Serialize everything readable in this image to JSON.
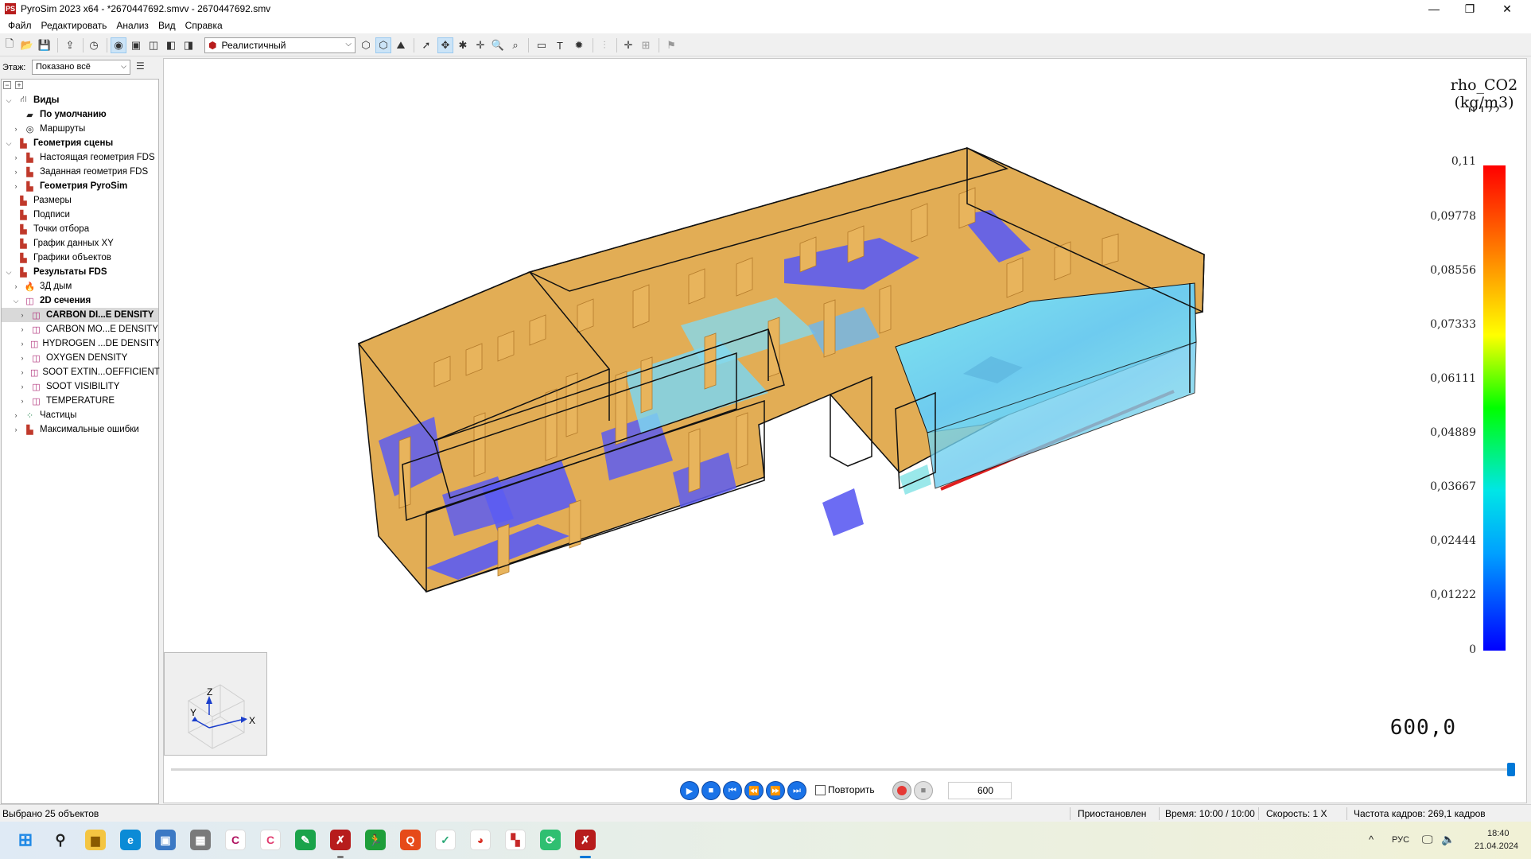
{
  "window": {
    "title": "PyroSim 2023 x64 - *2670447692.smvv - 2670447692.smv",
    "app_icon_text": "PS",
    "controls": {
      "minimize": "—",
      "maximize": "❐",
      "close": "✕"
    }
  },
  "menu": {
    "items": [
      "Файл",
      "Редактировать",
      "Анализ",
      "Вид",
      "Справка"
    ]
  },
  "toolbar": {
    "view_mode": "Реалистичный",
    "text_tool_glyph": "T"
  },
  "floor": {
    "label": "Этаж:",
    "value": "Показано всё"
  },
  "tree": {
    "views": "Виды",
    "default_view": "По умолчанию",
    "routes": "Маршруты",
    "scene_geometry": "Геометрия сцены",
    "actual_fds_geometry": "Настоящая геометрия FDS",
    "specified_fds_geometry": "Заданная геометрия FDS",
    "pyrosim_geometry": "Геометрия PyroSim",
    "dimensions": "Размеры",
    "labels": "Подписи",
    "sample_points": "Точки отбора",
    "xy_plots": "График данных XY",
    "object_plots": "Графики объектов",
    "fds_results": "Результаты FDS",
    "smoke_3d": "3Д дым",
    "slices_2d": "2D сечения",
    "slice_items": [
      "CARBON DI...E DENSITY",
      "CARBON MO...E DENSITY",
      "HYDROGEN ...DE DENSITY",
      "OXYGEN DENSITY",
      "SOOT EXTIN...OEFFICIENT",
      "SOOT VISIBILITY",
      "TEMPERATURE"
    ],
    "particles": "Частицы",
    "max_errors": "Максимальные ошибки"
  },
  "legend": {
    "quantity": "rho_CO2",
    "unit": "(kg/m3)",
    "clipped_value": "0,122",
    "ticks": [
      "0,11",
      "0,09778",
      "0,08556",
      "0,07333",
      "0,06111",
      "0,04889",
      "0,03667",
      "0,02444",
      "0,01222",
      "0"
    ]
  },
  "orientation": {
    "x": "X",
    "y": "Y",
    "z": "Z"
  },
  "time_readout": "600,0",
  "playback": {
    "repeat_label": "Повторить",
    "frame": "600",
    "slider_fraction": 1.0
  },
  "status": {
    "selection": "Выбрано 25 объектов",
    "state": "Приостановлен",
    "time": "Время: 10:00 / 10:00",
    "speed": "Скорость: 1 X",
    "fps": "Частота кадров: 269,1 кадров"
  },
  "taskbar": {
    "tray_chevron": "^",
    "language": "РУС",
    "clock_time": "18:40",
    "clock_date": "21.04.2024"
  },
  "colors": {
    "accent": "#0078d7",
    "wall": "#e2ad55",
    "low_conc": "#5c5cf2",
    "mid_conc": "#7ad8ef",
    "hot_line": "#e02020"
  }
}
